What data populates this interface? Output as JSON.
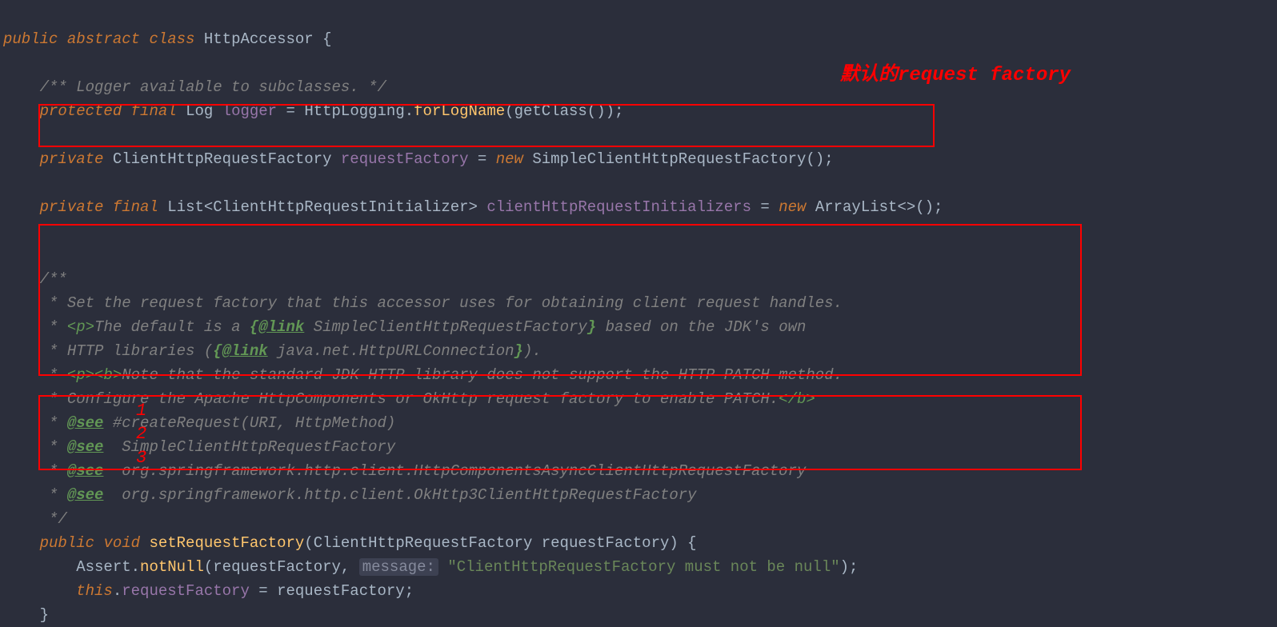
{
  "annotation": {
    "label": "默认的request factory",
    "num1": "1",
    "num2": "2",
    "num3": "3"
  },
  "code": {
    "l1_public": "public",
    "l1_abstract": "abstract",
    "l1_class": "class",
    "l1_name": "HttpAccessor",
    "l1_brace": " {",
    "l3_comment": "/** Logger available to subclasses. */",
    "l4_protected": "protected",
    "l4_final": "final",
    "l4_type": "Log ",
    "l4_field": "logger",
    "l4_eq": " = ",
    "l4_http": "HttpLogging",
    "l4_dot1": ".",
    "l4_method": "forLogName",
    "l4_p1": "(",
    "l4_get": "getClass",
    "l4_p2": "());",
    "l6_private": "private",
    "l6_type": " ClientHttpRequestFactory ",
    "l6_field": "requestFactory",
    "l6_eq": " = ",
    "l6_new": "new",
    "l6_ctor": " SimpleClientHttpRequestFactory();",
    "l8_private": "private",
    "l8_final": "final",
    "l8_type": " List<ClientHttpRequestInitializer> ",
    "l8_field": "clientHttpRequestInitializers",
    "l8_eq": " = ",
    "l8_new": "new",
    "l8_ctor": " ArrayList<>();",
    "d1": "/**",
    "d2": " * Set the request factory that this accessor uses for obtaining client request handles.",
    "d3a": " * ",
    "d3_p": "<p>",
    "d3b": "The default is a ",
    "d3_lb": "{",
    "d3_link": "@link",
    "d3_linktxt": " SimpleClientHttpRequestFactory",
    "d3_rb": "}",
    "d3c": " based on the JDK's own",
    "d4a": " * HTTP libraries (",
    "d4_lb": "{",
    "d4_link": "@link",
    "d4_linktxt": " java.net.HttpURLConnection",
    "d4_rb": "}",
    "d4b": ").",
    "d5a": " * ",
    "d5_p": "<p><b>",
    "d5b": "Note that the standard JDK HTTP library does not support the HTTP PATCH method.",
    "d6a": " * Configure the Apache HttpComponents or OkHttp request factory to enable PATCH.",
    "d6_b": "</b>",
    "d7a": " * ",
    "d7_see": "@see",
    "d7b": " ",
    "d7_link": "#createRequest(URI, HttpMethod)",
    "d8a": " * ",
    "d8_see": "@see",
    "d8b": "  SimpleClientHttpRequestFactory",
    "d9a": " * ",
    "d9_see": "@see",
    "d9b": "  org.springframework.http.client.HttpComponentsAsyncClientHttpRequestFactory",
    "d10a": " * ",
    "d10_see": "@see",
    "d10b": "  org.springframework.http.client.OkHttp3ClientHttpRequestFactory",
    "d11": " */",
    "m1_public": "public",
    "m1_void": "void",
    "m1_name": "setRequestFactory",
    "m1_p1": "(ClientHttpRequestFactory requestFactory) {",
    "m2a": "Assert.",
    "m2_method": "notNull",
    "m2b": "(requestFactory, ",
    "m2_hint": "message:",
    "m2_str": "\"ClientHttpRequestFactory must not be null\"",
    "m2c": ");",
    "m3_this": "this",
    "m3a": ".",
    "m3_field": "requestFactory",
    "m3b": " = requestFactory;",
    "m4": "}"
  }
}
